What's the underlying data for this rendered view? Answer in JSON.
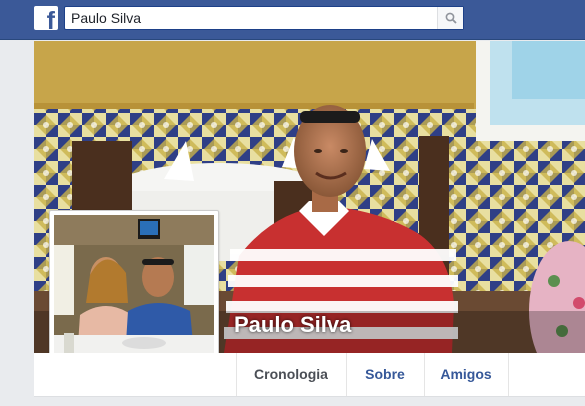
{
  "search": {
    "value": "Paulo Silva",
    "icon": "magnifier"
  },
  "header": {
    "logo_icon": "facebook-f"
  },
  "profile": {
    "name": "Paulo Silva"
  },
  "tabs": [
    {
      "label": "Cronologia",
      "active": true
    },
    {
      "label": "Sobre",
      "active": false
    },
    {
      "label": "Amigos",
      "active": false
    }
  ],
  "colors": {
    "brand_blue": "#3b5998",
    "link_blue": "#365899"
  }
}
